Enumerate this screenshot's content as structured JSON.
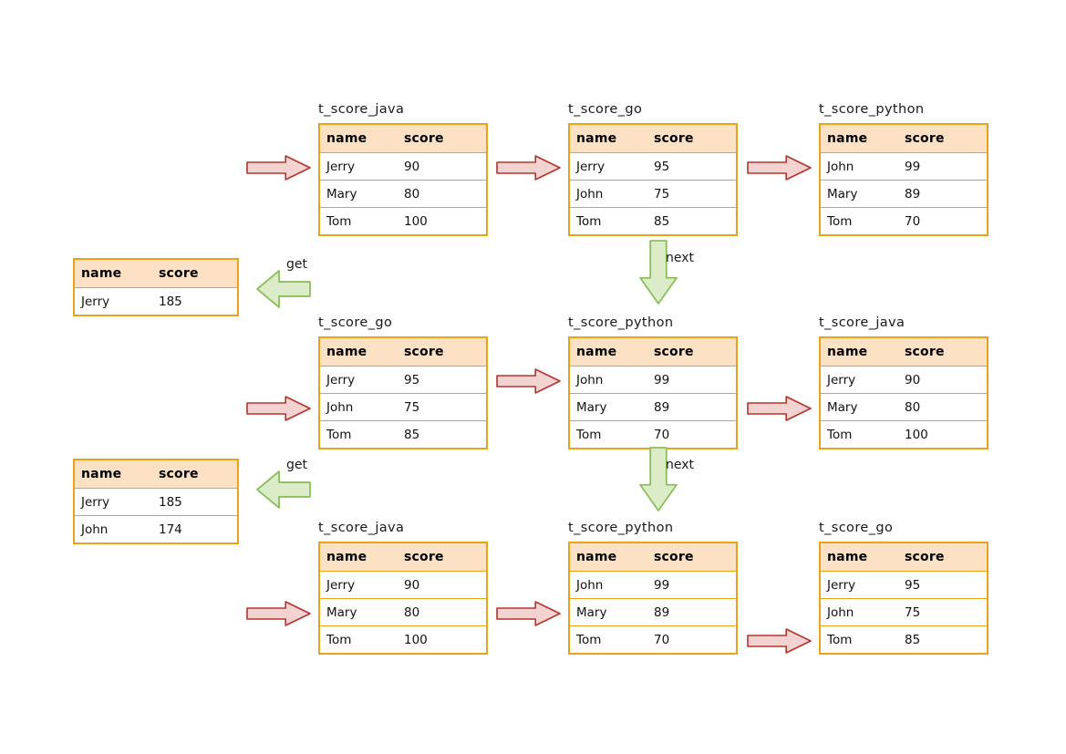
{
  "diagram": {
    "title_prefix": "t_",
    "columns": [
      "name",
      "score"
    ],
    "grid": [
      {
        "row_index": 0,
        "tables": [
          {
            "title": "t_score_java",
            "rows": [
              {
                "name": "Jerry",
                "score": "90"
              },
              {
                "name": "Mary",
                "score": "80"
              },
              {
                "name": "Tom",
                "score": "100"
              }
            ],
            "pointer_row": 0
          },
          {
            "title": "t_score_go",
            "rows": [
              {
                "name": "Jerry",
                "score": "95"
              },
              {
                "name": "John",
                "score": "75"
              },
              {
                "name": "Tom",
                "score": "85"
              }
            ],
            "pointer_row": 0
          },
          {
            "title": "t_score_python",
            "rows": [
              {
                "name": "John",
                "score": "99"
              },
              {
                "name": "Mary",
                "score": "89"
              },
              {
                "name": "Tom",
                "score": "70"
              }
            ],
            "pointer_row": 0
          }
        ]
      },
      {
        "row_index": 1,
        "tables": [
          {
            "title": "t_score_go",
            "rows": [
              {
                "name": "Jerry",
                "score": "95"
              },
              {
                "name": "John",
                "score": "75"
              },
              {
                "name": "Tom",
                "score": "85"
              }
            ],
            "pointer_row": 1
          },
          {
            "title": "t_score_python",
            "rows": [
              {
                "name": "John",
                "score": "99"
              },
              {
                "name": "Mary",
                "score": "89"
              },
              {
                "name": "Tom",
                "score": "70"
              }
            ],
            "pointer_row": 0
          },
          {
            "title": "t_score_java",
            "rows": [
              {
                "name": "Jerry",
                "score": "90"
              },
              {
                "name": "Mary",
                "score": "80"
              },
              {
                "name": "Tom",
                "score": "100"
              }
            ],
            "pointer_row": 1
          }
        ]
      },
      {
        "row_index": 2,
        "tables": [
          {
            "title": "t_score_java",
            "rows": [
              {
                "name": "Jerry",
                "score": "90"
              },
              {
                "name": "Mary",
                "score": "80"
              },
              {
                "name": "Tom",
                "score": "100"
              }
            ],
            "pointer_row": 1
          },
          {
            "title": "t_score_python",
            "rows": [
              {
                "name": "John",
                "score": "99"
              },
              {
                "name": "Mary",
                "score": "89"
              },
              {
                "name": "Tom",
                "score": "70"
              }
            ],
            "pointer_row": 1
          },
          {
            "title": "t_score_go",
            "rows": [
              {
                "name": "Jerry",
                "score": "95"
              },
              {
                "name": "John",
                "score": "75"
              },
              {
                "name": "Tom",
                "score": "85"
              }
            ],
            "pointer_row": 2
          }
        ]
      }
    ],
    "results": [
      {
        "label": "get",
        "rows": [
          {
            "name": "Jerry",
            "score": "185"
          }
        ]
      },
      {
        "label": "get",
        "rows": [
          {
            "name": "Jerry",
            "score": "185"
          },
          {
            "name": "John",
            "score": "174"
          }
        ]
      }
    ],
    "next_labels": [
      "next",
      "next"
    ],
    "colors": {
      "header_fill": "#FCE1C4",
      "table_border": "#E8A317",
      "row_fill": "#FFFFFF",
      "pink_arrow_fill": "#F3D2D2",
      "pink_arrow_stroke": "#B5342B",
      "green_arrow_fill": "#DCEBC8",
      "green_arrow_stroke": "#8CBF5A",
      "text": "#111111"
    }
  }
}
